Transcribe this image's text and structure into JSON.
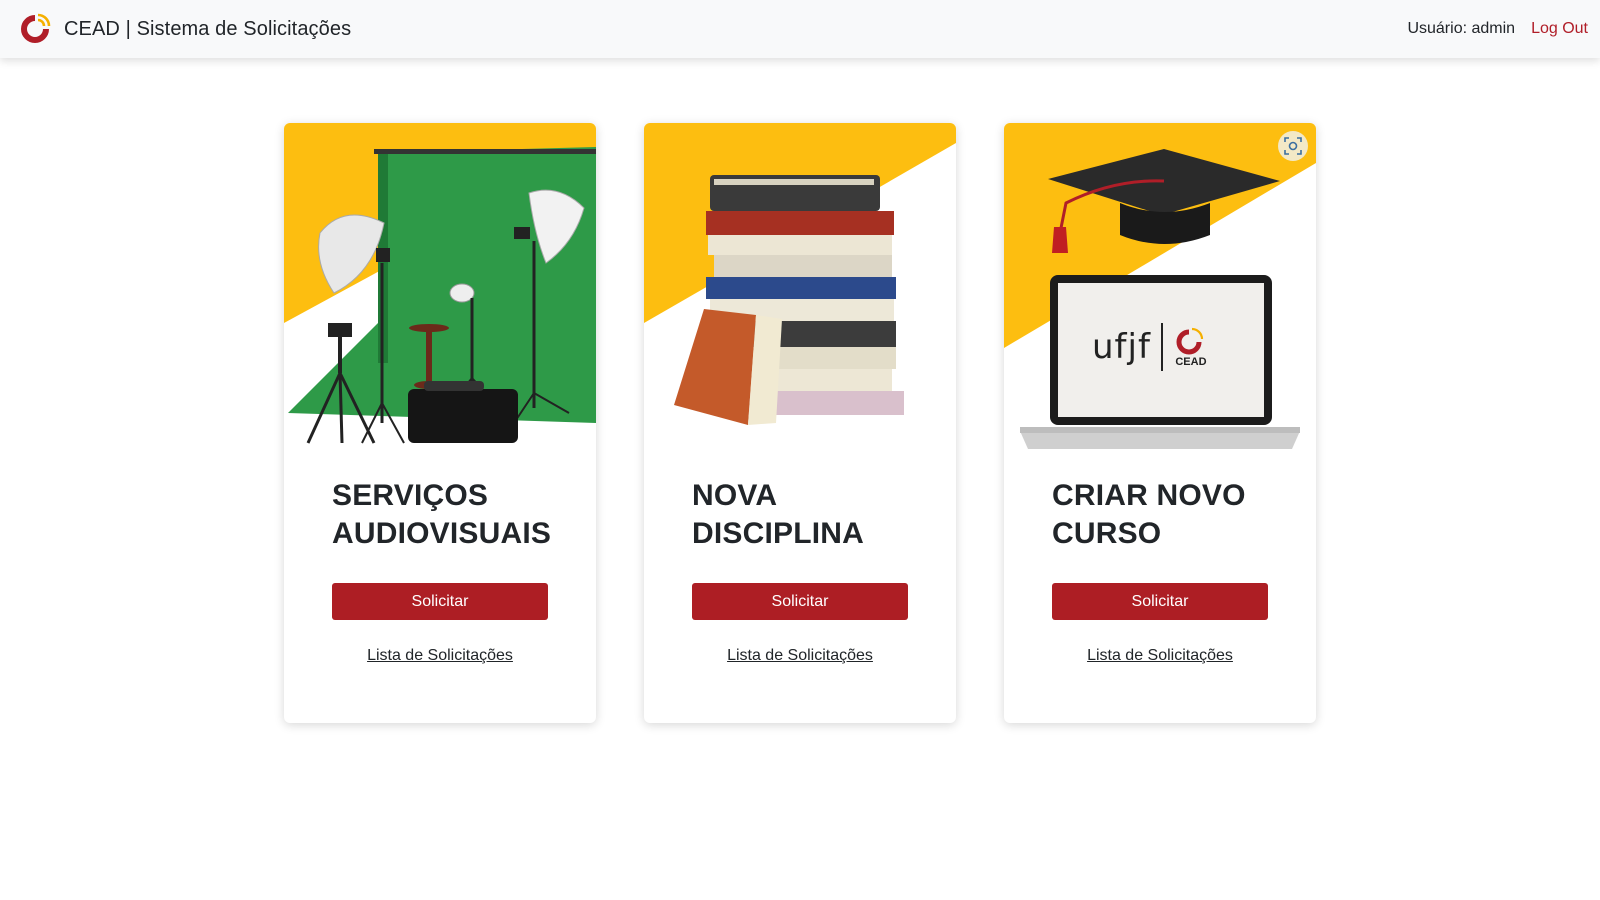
{
  "header": {
    "title": "CEAD | Sistema de Solicitações",
    "user": "Usuário: admin",
    "logout": "Log Out"
  },
  "colors": {
    "accent": "#ad1e24",
    "yellow": "#fdbe10",
    "green": "#2e9a48"
  },
  "cards": [
    {
      "title_line1": "SERVIÇOS",
      "title_line2": "AUDIOVISUAIS",
      "button": "Solicitar",
      "link": "Lista de Solicitações",
      "image": "photo-studio-equipment"
    },
    {
      "title_line1": "NOVA",
      "title_line2": "DISCIPLINA",
      "button": "Solicitar",
      "link": "Lista de Solicitações",
      "image": "stack-of-books"
    },
    {
      "title_line1": "CRIAR NOVO",
      "title_line2": "CURSO",
      "button": "Solicitar",
      "link": "Lista de Solicitações",
      "image": "graduation-cap-and-laptop",
      "laptop_logo": "ufjf",
      "laptop_logo_sub": "CEAD"
    }
  ]
}
